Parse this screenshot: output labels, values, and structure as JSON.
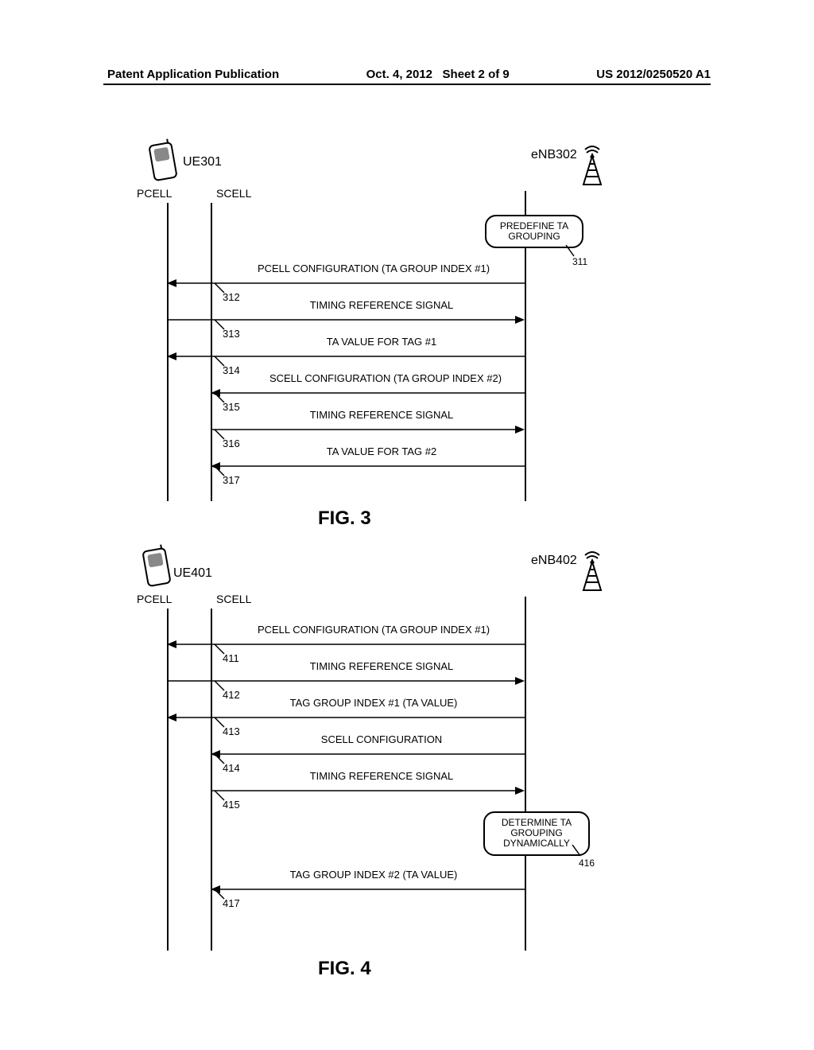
{
  "header": {
    "left": "Patent Application Publication",
    "center": "Oct. 4, 2012",
    "sheet": "Sheet 2 of 9",
    "right": "US 2012/0250520 A1"
  },
  "fig3": {
    "ue_label": "UE301",
    "enb_label": "eNB302",
    "pcell_label": "PCELL",
    "scell_label": "SCELL",
    "bubble": "PREDEFINE TA GROUPING",
    "bubble_ref": "311",
    "messages": [
      {
        "ref": "312",
        "text": "PCELL CONFIGURATION (TA GROUP INDEX #1)",
        "dir": "left",
        "from": "enb",
        "to": "pcell"
      },
      {
        "ref": "313",
        "text": "TIMING REFERENCE SIGNAL",
        "dir": "right",
        "from": "pcell",
        "to": "enb"
      },
      {
        "ref": "314",
        "text": "TA VALUE FOR TAG #1",
        "dir": "left",
        "from": "enb",
        "to": "pcell"
      },
      {
        "ref": "315",
        "text": "SCELL CONFIGURATION (TA GROUP INDEX #2)",
        "dir": "left",
        "from": "enb",
        "to": "scell"
      },
      {
        "ref": "316",
        "text": "TIMING REFERENCE SIGNAL",
        "dir": "right",
        "from": "scell",
        "to": "enb"
      },
      {
        "ref": "317",
        "text": "TA VALUE FOR TAG #2",
        "dir": "left",
        "from": "enb",
        "to": "scell"
      }
    ],
    "caption": "FIG. 3"
  },
  "fig4": {
    "ue_label": "UE401",
    "enb_label": "eNB402",
    "pcell_label": "PCELL",
    "scell_label": "SCELL",
    "bubble": "DETERMINE TA GROUPING DYNAMICALLY",
    "bubble_ref": "416",
    "messages": [
      {
        "ref": "411",
        "text": "PCELL CONFIGURATION (TA GROUP INDEX #1)",
        "dir": "left",
        "from": "enb",
        "to": "pcell"
      },
      {
        "ref": "412",
        "text": "TIMING REFERENCE SIGNAL",
        "dir": "right",
        "from": "pcell",
        "to": "enb"
      },
      {
        "ref": "413",
        "text": "TAG GROUP INDEX #1 (TA VALUE)",
        "dir": "left",
        "from": "enb",
        "to": "pcell"
      },
      {
        "ref": "414",
        "text": "SCELL CONFIGURATION",
        "dir": "left",
        "from": "enb",
        "to": "scell"
      },
      {
        "ref": "415",
        "text": "TIMING REFERENCE SIGNAL",
        "dir": "right",
        "from": "scell",
        "to": "enb"
      },
      {
        "ref": "417",
        "text": "TAG GROUP INDEX #2 (TA VALUE)",
        "dir": "left",
        "from": "enb",
        "to": "scell"
      }
    ],
    "caption": "FIG. 4"
  },
  "chart_data": [
    {
      "type": "sequence-diagram",
      "id": "FIG3",
      "actors": [
        {
          "id": "pcell",
          "label": "PCELL (UE301)"
        },
        {
          "id": "scell",
          "label": "SCELL (UE301)"
        },
        {
          "id": "enb",
          "label": "eNB302"
        }
      ],
      "process_note": {
        "at": "enb",
        "text": "PREDEFINE TA GROUPING",
        "ref": "311"
      },
      "messages": [
        {
          "ref": "312",
          "from": "enb",
          "to": "pcell",
          "text": "PCELL CONFIGURATION (TA GROUP INDEX #1)"
        },
        {
          "ref": "313",
          "from": "pcell",
          "to": "enb",
          "text": "TIMING REFERENCE SIGNAL"
        },
        {
          "ref": "314",
          "from": "enb",
          "to": "pcell",
          "text": "TA VALUE FOR TAG #1"
        },
        {
          "ref": "315",
          "from": "enb",
          "to": "scell",
          "text": "SCELL CONFIGURATION (TA GROUP INDEX #2)"
        },
        {
          "ref": "316",
          "from": "scell",
          "to": "enb",
          "text": "TIMING REFERENCE SIGNAL"
        },
        {
          "ref": "317",
          "from": "enb",
          "to": "scell",
          "text": "TA VALUE FOR TAG #2"
        }
      ]
    },
    {
      "type": "sequence-diagram",
      "id": "FIG4",
      "actors": [
        {
          "id": "pcell",
          "label": "PCELL (UE401)"
        },
        {
          "id": "scell",
          "label": "SCELL (UE401)"
        },
        {
          "id": "enb",
          "label": "eNB402"
        }
      ],
      "process_note": {
        "at": "enb",
        "text": "DETERMINE TA GROUPING DYNAMICALLY",
        "ref": "416",
        "after_ref": "415"
      },
      "messages": [
        {
          "ref": "411",
          "from": "enb",
          "to": "pcell",
          "text": "PCELL CONFIGURATION (TA GROUP INDEX #1)"
        },
        {
          "ref": "412",
          "from": "pcell",
          "to": "enb",
          "text": "TIMING REFERENCE SIGNAL"
        },
        {
          "ref": "413",
          "from": "enb",
          "to": "pcell",
          "text": "TAG GROUP INDEX #1 (TA VALUE)"
        },
        {
          "ref": "414",
          "from": "enb",
          "to": "scell",
          "text": "SCELL CONFIGURATION"
        },
        {
          "ref": "415",
          "from": "scell",
          "to": "enb",
          "text": "TIMING REFERENCE SIGNAL"
        },
        {
          "ref": "417",
          "from": "enb",
          "to": "scell",
          "text": "TAG GROUP INDEX #2 (TA VALUE)"
        }
      ]
    }
  ]
}
